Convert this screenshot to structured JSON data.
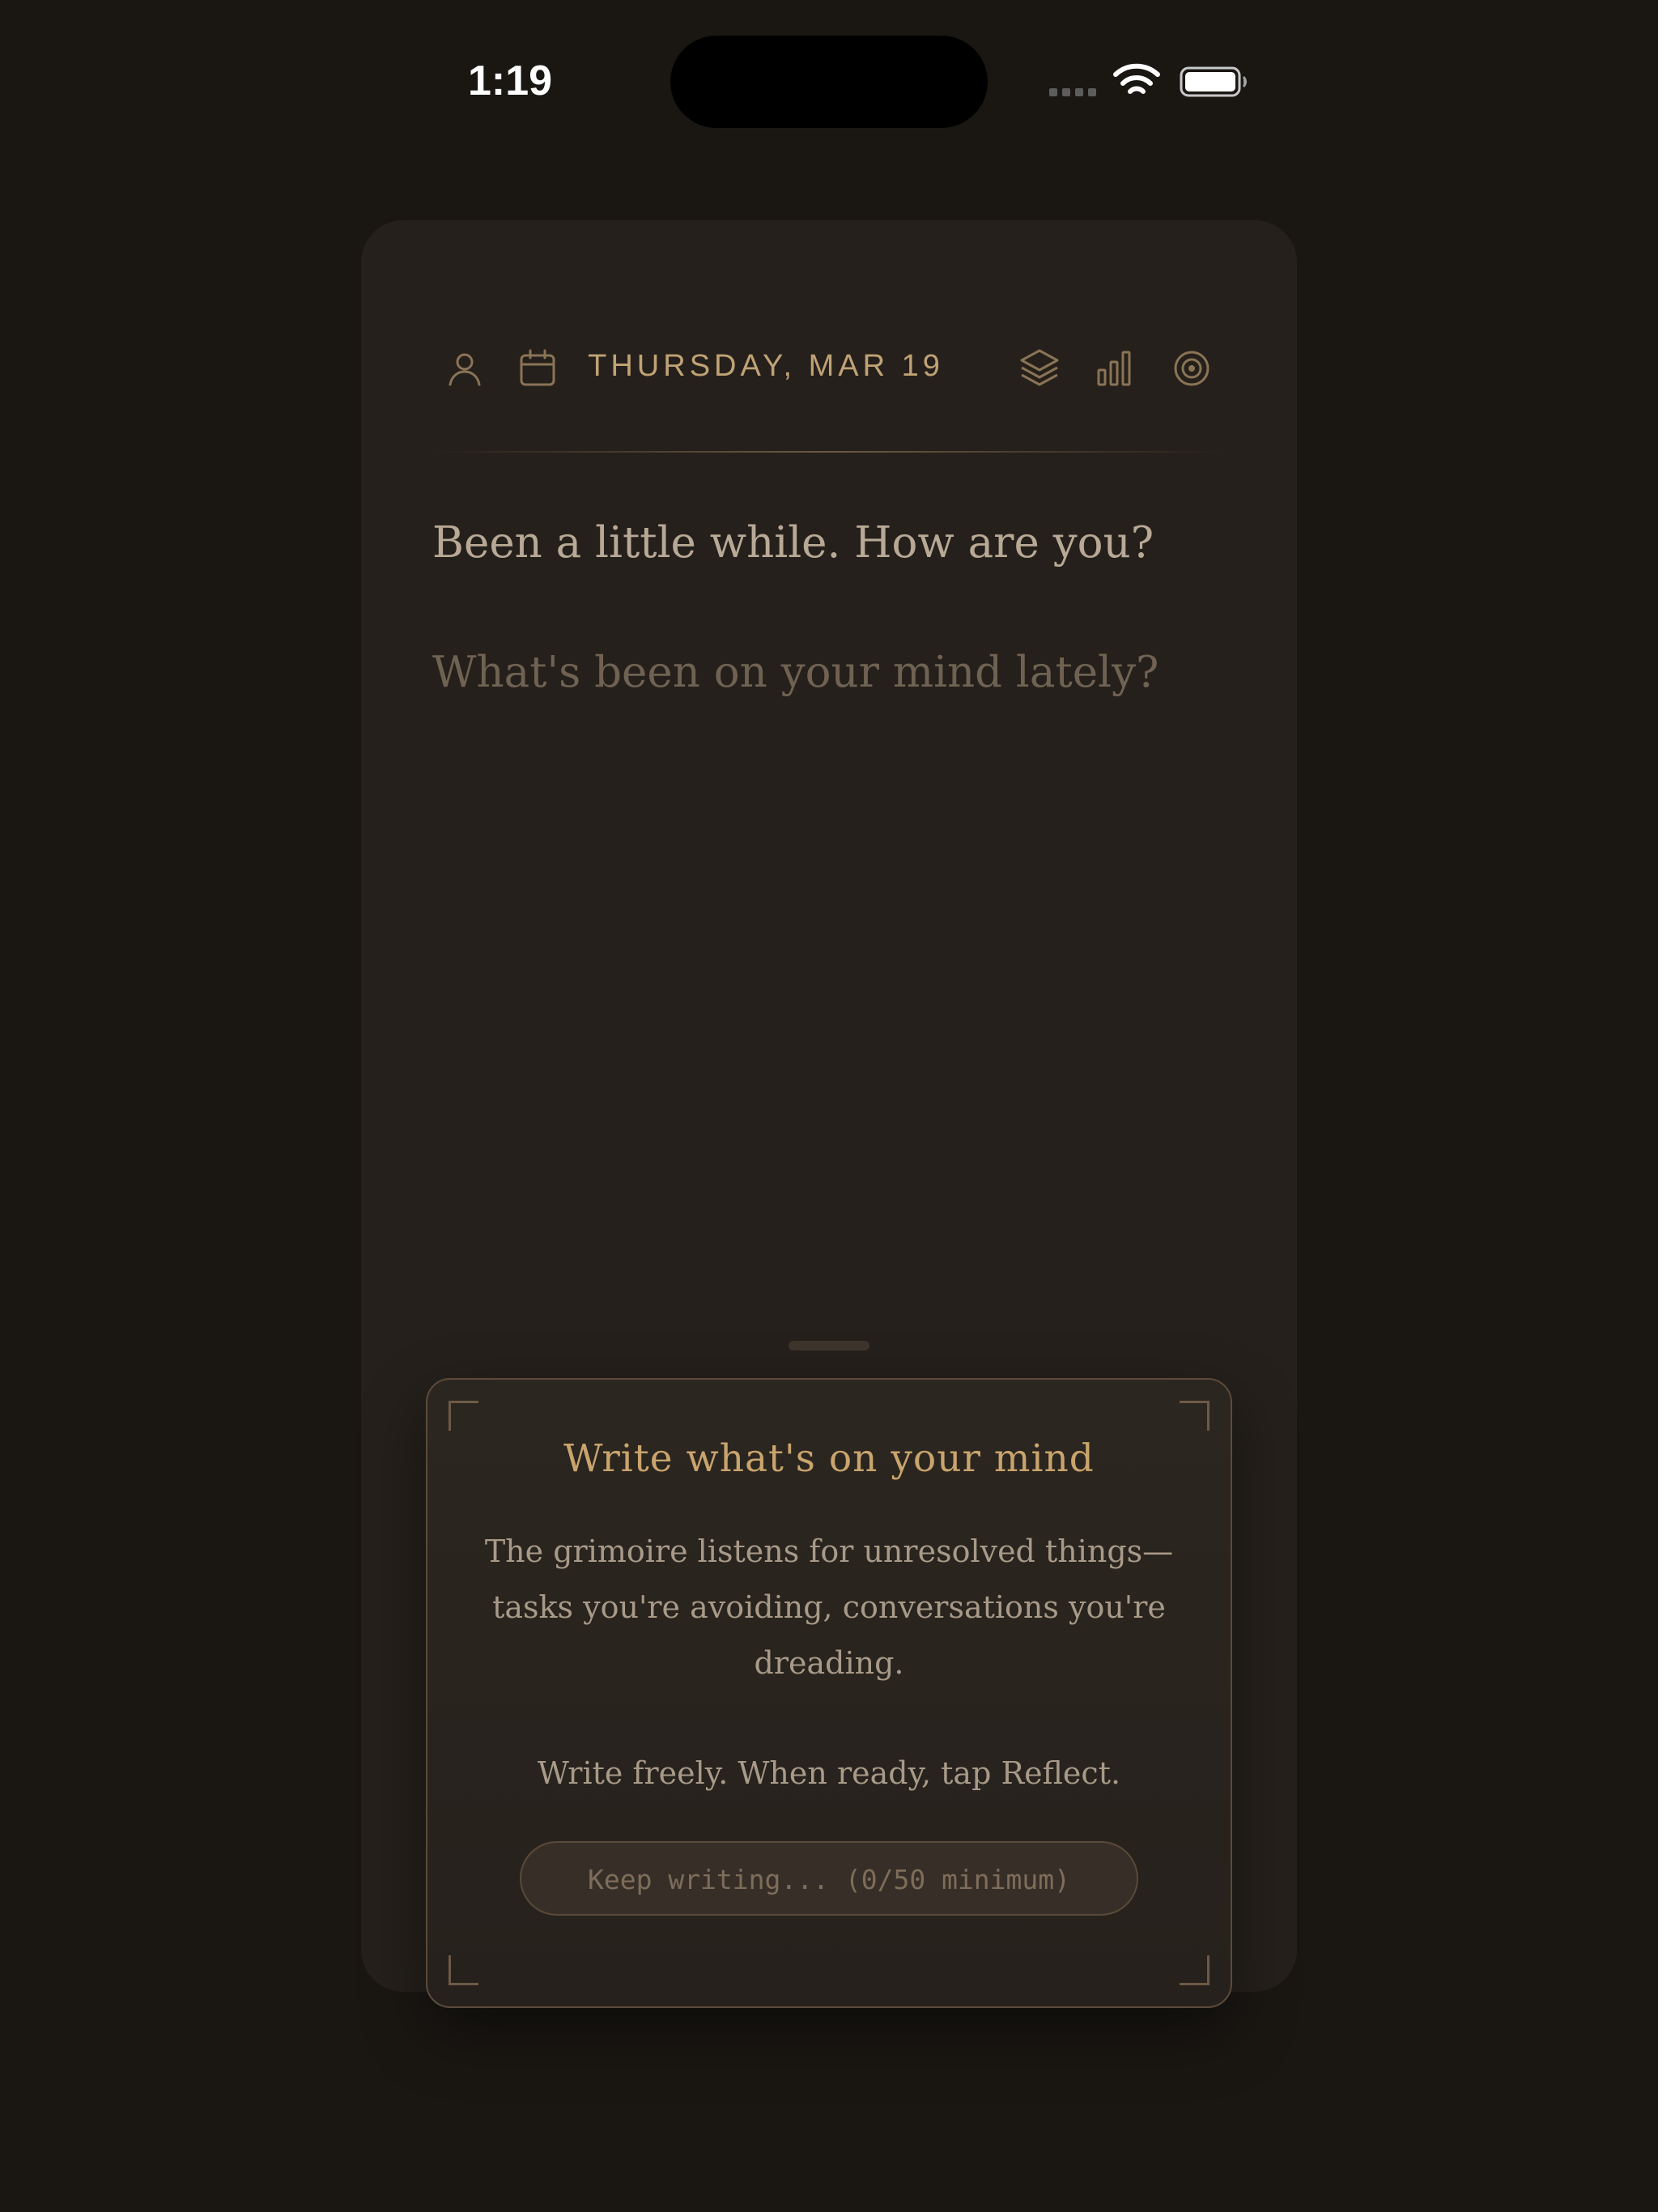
{
  "status_bar": {
    "time": "1:19",
    "icons": [
      "cellular-signal-icon",
      "wifi-icon",
      "battery-icon"
    ]
  },
  "header": {
    "left_icons": [
      "profile-icon",
      "calendar-icon"
    ],
    "date": "THURSDAY, MAR 19",
    "right_icons": [
      "layers-icon",
      "bar-chart-icon",
      "target-icon"
    ]
  },
  "journal": {
    "greeting": "Been a little while. How are you?",
    "entry_placeholder": "What's been on your mind lately?"
  },
  "prompt_panel": {
    "title": "Write what's on your mind",
    "body_lines": [
      "The grimoire listens for unresolved things—",
      "tasks you're avoiding, conversations you're",
      "dreading."
    ],
    "cta_text": "Write freely. When ready, tap Reflect.",
    "progress_label": "Keep writing... (0/50 minimum)",
    "progress_count": 0,
    "progress_minimum": 50
  },
  "colors": {
    "background": "#1a1713",
    "card": "#25201b",
    "accent_gold": "#c9a46d",
    "icon": "#8a7456",
    "text_primary": "#b8a996",
    "text_placeholder": "#6f6252"
  }
}
